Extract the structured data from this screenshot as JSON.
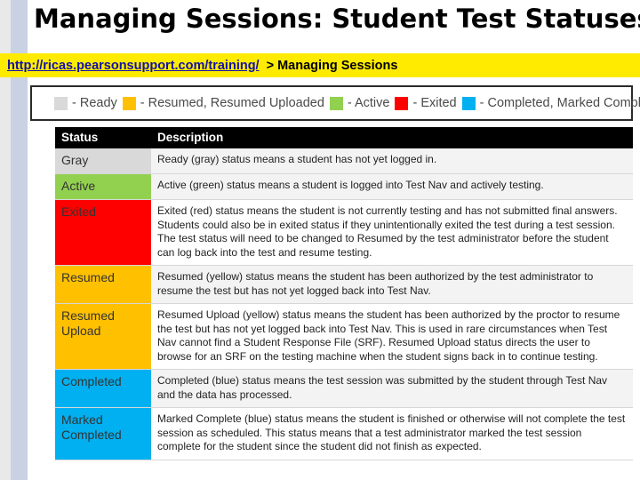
{
  "title": "Managing Sessions: Student Test Statuses",
  "breadcrumb": {
    "url": "http://ricas.pearsonsupport.com/training/",
    "separator": ">",
    "current": "Managing Sessions"
  },
  "legend": [
    {
      "label": "- Ready",
      "color": "#d9d9d9"
    },
    {
      "label": "- Resumed, Resumed Uploaded",
      "color": "#ffc000"
    },
    {
      "label": "- Active",
      "color": "#92d050"
    },
    {
      "label": "- Exited",
      "color": "#ff0000"
    },
    {
      "label": "- Completed, Marked Complete",
      "color": "#00b0f0"
    }
  ],
  "table": {
    "headers": [
      "Status",
      "Description"
    ],
    "rows": [
      {
        "status": "Gray",
        "status_bg": "#d9d9d9",
        "desc_bg": "#f3f3f3",
        "description": "Ready (gray) status means a student has not yet logged in."
      },
      {
        "status": "Active",
        "status_bg": "#92d050",
        "desc_bg": "#f3f3f3",
        "description": "Active (green) status means a student is logged into Test Nav and actively testing."
      },
      {
        "status": "Exited",
        "status_bg": "#ff0000",
        "desc_bg": "#ffffff",
        "description": "Exited (red) status means the student is not currently testing and has not submitted final answers. Students could also be in exited status if they unintentionally exited the test during a test session. The test status will need to be changed to Resumed by the test administrator before the student can log back into the test and resume testing."
      },
      {
        "status": "Resumed",
        "status_bg": "#ffc000",
        "desc_bg": "#f3f3f3",
        "description": "Resumed (yellow) status means the student has been authorized by the test administrator to resume the test but has not yet logged back into Test Nav."
      },
      {
        "status": "Resumed Upload",
        "status_bg": "#ffc000",
        "desc_bg": "#ffffff",
        "description": "Resumed Upload (yellow) status means the student has been authorized by the proctor to resume the test but has not yet logged back into Test Nav. This is used in rare circumstances when Test Nav cannot find a Student Response File (SRF). Resumed Upload status directs the user to browse for an SRF on the testing machine when the student signs back in to continue testing."
      },
      {
        "status": "Completed",
        "status_bg": "#00b0f0",
        "desc_bg": "#f3f3f3",
        "description": "Completed (blue) status means the test session was submitted by the student through Test Nav and the data has processed."
      },
      {
        "status": "Marked Completed",
        "status_bg": "#00b0f0",
        "desc_bg": "#ffffff",
        "description": "Marked Complete (blue) status means the student is finished or otherwise will not complete the test session as scheduled. This status means that a test administrator marked the test session complete for the student since the student did not finish as expected."
      }
    ]
  }
}
